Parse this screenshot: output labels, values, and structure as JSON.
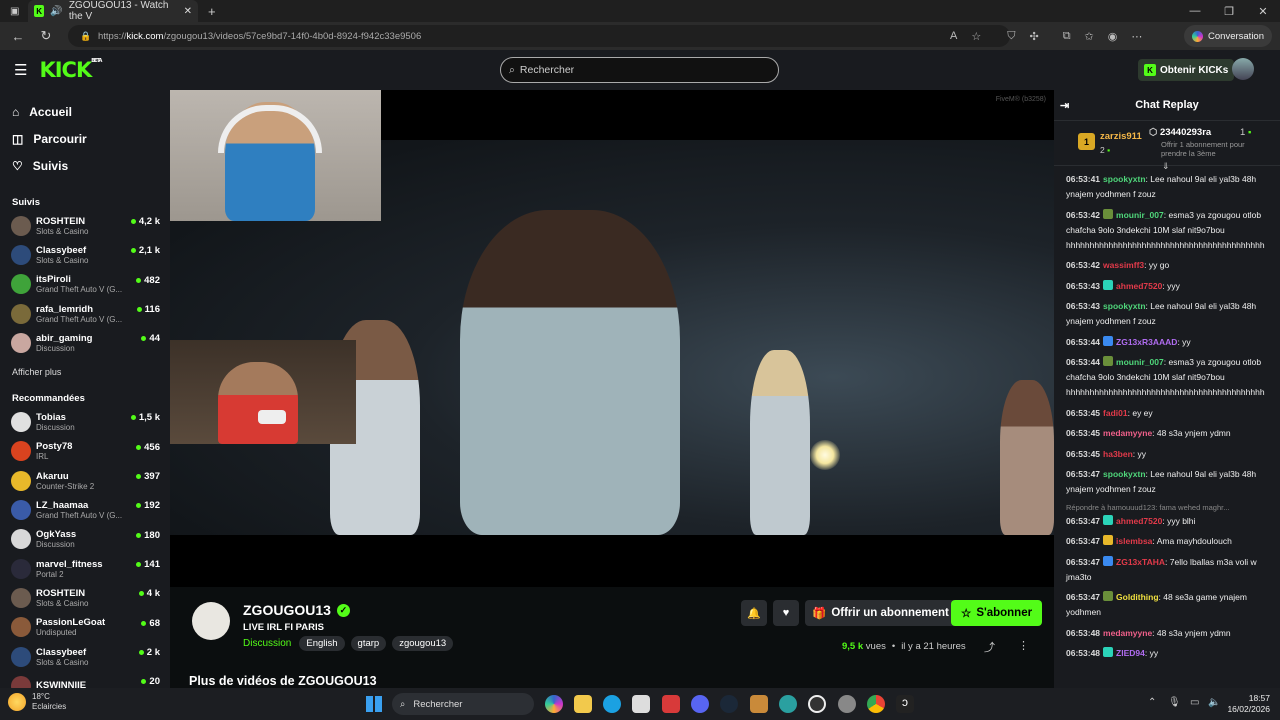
{
  "browser": {
    "tab_title": "ZGOUGOU13 - Watch the V",
    "url_prefix": "https://",
    "url_domain": "kick.com",
    "url_path": "/zgougou13/videos/57ce9bd7-14f0-4b0d-8924-f942c33e9506",
    "conversation_label": "Conversation"
  },
  "header": {
    "logo": "KICK",
    "logo_sup": "BETA",
    "search_placeholder": "Rechercher",
    "obtain_label": "Obtenir KICKs"
  },
  "sidebar": {
    "nav": [
      {
        "label": "Accueil",
        "icon": "home-icon"
      },
      {
        "label": "Parcourir",
        "icon": "compass-icon"
      },
      {
        "label": "Suivis",
        "icon": "heart-icon"
      }
    ],
    "following_header": "Suivis",
    "following": [
      {
        "name": "ROSHTEIN",
        "category": "Slots & Casino",
        "viewers": "4,2 k",
        "color": "#6b5b4f"
      },
      {
        "name": "Classybeef",
        "category": "Slots & Casino",
        "viewers": "2,1 k",
        "color": "#2d4b7a"
      },
      {
        "name": "itsPiroli",
        "category": "Grand Theft Auto V (G...",
        "viewers": "482",
        "color": "#3fa33a"
      },
      {
        "name": "rafa_lemridh",
        "category": "Grand Theft Auto V (G...",
        "viewers": "116",
        "color": "#7a6a3a"
      },
      {
        "name": "abir_gaming",
        "category": "Discussion",
        "viewers": "44",
        "color": "#c9a7a0"
      }
    ],
    "show_more": "Afficher plus",
    "recommended_header": "Recommandées",
    "recommended": [
      {
        "name": "Tobias",
        "category": "Discussion",
        "viewers": "1,5 k",
        "color": "#e0e0e0"
      },
      {
        "name": "Posty78",
        "category": "IRL",
        "viewers": "456",
        "color": "#d9431f"
      },
      {
        "name": "Akaruu",
        "category": "Counter-Strike 2",
        "viewers": "397",
        "color": "#e8b82a"
      },
      {
        "name": "LZ_haamaa",
        "category": "Grand Theft Auto V (G...",
        "viewers": "192",
        "color": "#3a5ba8"
      },
      {
        "name": "OgkYass",
        "category": "Discussion",
        "viewers": "180",
        "color": "#d8d8d8"
      },
      {
        "name": "marvel_fitness",
        "category": "Portal 2",
        "viewers": "141",
        "color": "#2a2a3a"
      },
      {
        "name": "ROSHTEIN",
        "category": "Slots & Casino",
        "viewers": "4 k",
        "color": "#6b5b4f"
      },
      {
        "name": "PassionLeGoat",
        "category": "Undisputed",
        "viewers": "68",
        "color": "#8a5a3a"
      },
      {
        "name": "Classybeef",
        "category": "Slots & Casino",
        "viewers": "2 k",
        "color": "#2d4b7a"
      },
      {
        "name": "KSWINNIIE",
        "category": "",
        "viewers": "20",
        "color": "#7a3a3a"
      }
    ]
  },
  "video": {
    "watermark": "FiveM® (b3258)"
  },
  "stream": {
    "name": "ZGOUGOU13",
    "title": "LIVE IRL FI PARIS",
    "category": "Discussion",
    "tags": [
      "English",
      "gtarp",
      "zgougou13"
    ],
    "gift_label": "Offrir un abonnement",
    "subscribe_label": "S'abonner",
    "views_value": "9,5 k",
    "views_label": "vues",
    "time_ago": "il y a 21 heures",
    "more_videos": "Plus de vidéos de ZGOUGOU13"
  },
  "chat": {
    "title": "Chat Replay",
    "pinned": {
      "user1": "zarzis911",
      "count1": "2",
      "user2": "23440293ra",
      "count2": "1",
      "offer": "Offrir 1 abonnement pour prendre la 3ème"
    },
    "messages": [
      {
        "time": "06:53:41",
        "user": "spookyxtn",
        "color": "#4fd67a",
        "text": "Lee nahoul 9al eli yal3b 48h ynajem yodhmen f zouz",
        "badge": ""
      },
      {
        "time": "06:53:42",
        "user": "mounir_007",
        "color": "#4fd67a",
        "text": "esma3 ya zgougou otlob chafcha 9olo 3ndekchi 10M slaf nit9o7bou hhhhhhhhhhhhhhhhhhhhhhhhhhhhhhhhhhhhhhhhhh",
        "badge": "#6a8f3a"
      },
      {
        "time": "06:53:42",
        "user": "wassimff3",
        "color": "#e23a4a",
        "text": "yy go",
        "badge": ""
      },
      {
        "time": "06:53:43",
        "user": "ahmed7520",
        "color": "#e23a4a",
        "text": "yyy",
        "badge": "#2bd3b8"
      },
      {
        "time": "06:53:43",
        "user": "spookyxtn",
        "color": "#4fd67a",
        "text": "Lee nahoul 9al eli yal3b 48h ynajem yodhmen f zouz",
        "badge": ""
      },
      {
        "time": "06:53:44",
        "user": "ZG13xR3AAAD",
        "color": "#b06cf0",
        "text": "yy",
        "badge": "#3a8af0"
      },
      {
        "time": "06:53:44",
        "user": "mounir_007",
        "color": "#4fd67a",
        "text": "esma3 ya zgougou otlob chafcha 9olo 3ndekchi 10M slaf nit9o7bou hhhhhhhhhhhhhhhhhhhhhhhhhhhhhhhhhhhhhhhhhh",
        "badge": "#6a8f3a"
      },
      {
        "time": "06:53:45",
        "user": "fadi01",
        "color": "#e23a4a",
        "text": "ey ey",
        "badge": ""
      },
      {
        "time": "06:53:45",
        "user": "medamyyne",
        "color": "#f0608a",
        "text": "48 s3a ynjem ydmn",
        "badge": ""
      },
      {
        "time": "06:53:45",
        "user": "ha3ben",
        "color": "#e23a4a",
        "text": "yy",
        "badge": ""
      },
      {
        "time": "06:53:47",
        "user": "spookyxtn",
        "color": "#4fd67a",
        "text": "Lee nahoul 9al eli yal3b 48h ynajem yodhmen f zouz",
        "badge": ""
      },
      {
        "time": "06:53:47",
        "user": "ahmed7520",
        "color": "#e23a4a",
        "text": "yyy blhi",
        "badge": "#2bd3b8",
        "reply": "Répondre à hamouuud123: fama wehed maghr..."
      },
      {
        "time": "06:53:47",
        "user": "islembsa",
        "color": "#e23a4a",
        "text": "Ama mayhdoulouch",
        "badge": "#e8b82a"
      },
      {
        "time": "06:53:47",
        "user": "ZG13xTAHA",
        "color": "#e23a4a",
        "text": "7ello lballas m3a voli w jma3to",
        "badge": "#3a8af0"
      },
      {
        "time": "06:53:47",
        "user": "Goldithing",
        "color": "#f0e040",
        "text": "48 se3a game ynajem yodhmen",
        "badge": "#6a8f3a"
      },
      {
        "time": "06:53:48",
        "user": "medamyyne",
        "color": "#f0608a",
        "text": "48 s3a ynjem ydmn",
        "badge": ""
      },
      {
        "time": "06:53:48",
        "user": "ZIED94",
        "color": "#b06cf0",
        "text": "yy",
        "badge": "#2bd3b8"
      }
    ]
  },
  "taskbar": {
    "temp": "18°C",
    "weather": "Eclaircies",
    "search": "Rechercher",
    "time": "18:57",
    "date": "16/02/2026"
  }
}
